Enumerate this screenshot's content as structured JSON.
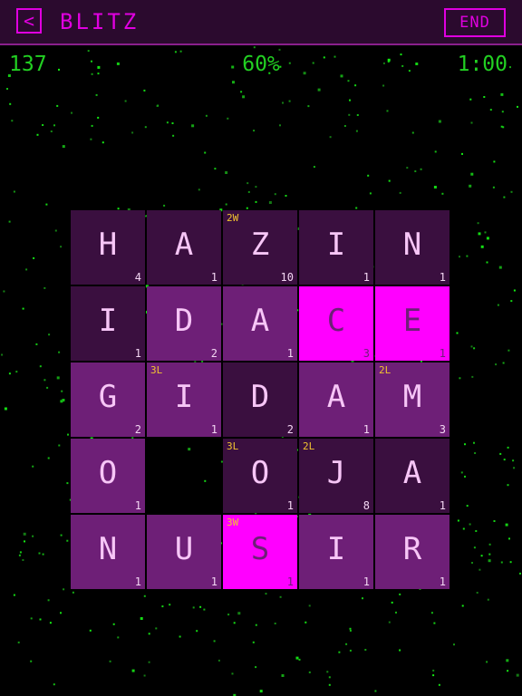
{
  "header": {
    "back_symbol": "<",
    "title": "BLITZ",
    "end_label": "END"
  },
  "stats": {
    "score": "137",
    "percent": "60%",
    "timer": "1:00"
  },
  "colors": {
    "accent": "#e000e0",
    "stats_text": "#22d022",
    "tile_dark": "#3a0f3f",
    "tile_mid": "#6e1f77",
    "tile_bright": "#ff00ff",
    "bonus_text": "#f2c430"
  },
  "board": {
    "rows": 5,
    "cols": 5,
    "tiles": [
      {
        "letter": "H",
        "points": "4",
        "bonus": "",
        "style": "dark"
      },
      {
        "letter": "A",
        "points": "1",
        "bonus": "",
        "style": "dark"
      },
      {
        "letter": "Z",
        "points": "10",
        "bonus": "2W",
        "style": "dark"
      },
      {
        "letter": "I",
        "points": "1",
        "bonus": "",
        "style": "dark"
      },
      {
        "letter": "N",
        "points": "1",
        "bonus": "",
        "style": "dark"
      },
      {
        "letter": "I",
        "points": "1",
        "bonus": "",
        "style": "dark"
      },
      {
        "letter": "D",
        "points": "2",
        "bonus": "",
        "style": "mid"
      },
      {
        "letter": "A",
        "points": "1",
        "bonus": "",
        "style": "mid"
      },
      {
        "letter": "C",
        "points": "3",
        "bonus": "",
        "style": "bright"
      },
      {
        "letter": "E",
        "points": "1",
        "bonus": "",
        "style": "bright"
      },
      {
        "letter": "G",
        "points": "2",
        "bonus": "",
        "style": "mid"
      },
      {
        "letter": "I",
        "points": "1",
        "bonus": "3L",
        "style": "mid"
      },
      {
        "letter": "D",
        "points": "2",
        "bonus": "",
        "style": "dark"
      },
      {
        "letter": "A",
        "points": "1",
        "bonus": "",
        "style": "mid"
      },
      {
        "letter": "M",
        "points": "3",
        "bonus": "2L",
        "style": "mid"
      },
      {
        "letter": "O",
        "points": "1",
        "bonus": "",
        "style": "mid"
      },
      null,
      {
        "letter": "O",
        "points": "1",
        "bonus": "3L",
        "style": "dark"
      },
      {
        "letter": "J",
        "points": "8",
        "bonus": "2L",
        "style": "dark"
      },
      {
        "letter": "A",
        "points": "1",
        "bonus": "",
        "style": "dark"
      },
      {
        "letter": "N",
        "points": "1",
        "bonus": "",
        "style": "mid"
      },
      {
        "letter": "U",
        "points": "1",
        "bonus": "",
        "style": "mid"
      },
      {
        "letter": "S",
        "points": "1",
        "bonus": "3W",
        "style": "bright"
      },
      {
        "letter": "I",
        "points": "1",
        "bonus": "",
        "style": "mid"
      },
      {
        "letter": "R",
        "points": "1",
        "bonus": "",
        "style": "mid"
      }
    ]
  }
}
